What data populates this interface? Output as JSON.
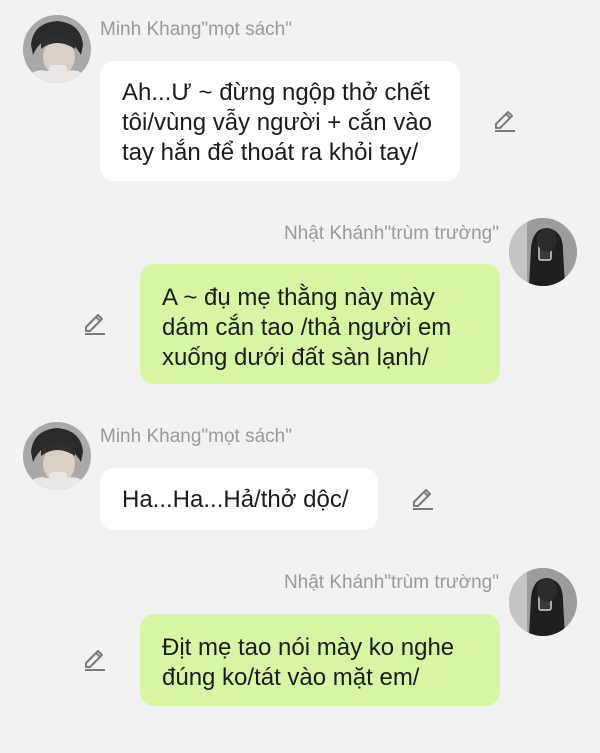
{
  "messages": [
    {
      "sender": "Minh Khang\"mọt sách\"",
      "side": "left",
      "text": "Ah...Ư ~ đừng ngộp thở chết\ntôi/vùng vẫy người + cắn vào\ntay hắn để thoát ra khỏi tay/"
    },
    {
      "sender": "Nhật Khánh\"trùm trường\"",
      "side": "right",
      "text": "A ~ đụ mẹ thằng này mày\ndám cắn tao /thả người em\nxuống dưới đất sàn lạnh/"
    },
    {
      "sender": "Minh Khang\"mọt sách\"",
      "side": "left",
      "text": "Ha...Ha...Hả/thở dộc/"
    },
    {
      "sender": "Nhật Khánh\"trùm trường\"",
      "side": "right",
      "text": "Địt mẹ tao nói mày ko nghe\nđúng ko/tát vào mặt em/"
    }
  ],
  "icons": {
    "edit": "pencil-edit-icon",
    "avatar": "user-avatar-photo"
  },
  "colors": {
    "background": "#f2f2f2",
    "incoming_bubble": "#ffffff",
    "outgoing_bubble": "#d7f5a3",
    "sender_name": "#9a9a9a"
  }
}
